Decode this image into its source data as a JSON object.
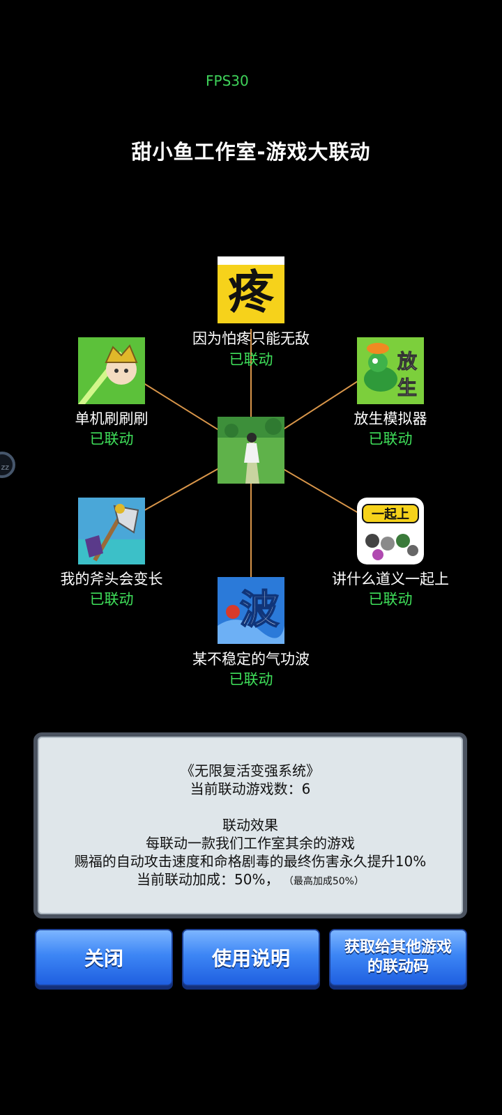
{
  "hud": {
    "fps": "FPS30",
    "side_handle": "zz"
  },
  "title": "甜小鱼工作室-游戏大联动",
  "center_game": {
    "icon": "girl-in-meadow-icon"
  },
  "games": [
    {
      "name": "因为怕疼只能无敌",
      "status": "已联动",
      "icon": "pain-character-icon",
      "icon_text": "疼"
    },
    {
      "name": "放生模拟器",
      "status": "已联动",
      "icon": "turtle-icon",
      "icon_text": "放生"
    },
    {
      "name": "讲什么道义一起上",
      "status": "已联动",
      "icon": "crowd-icon",
      "icon_text": "一起上"
    },
    {
      "name": "某不稳定的气功波",
      "status": "已联动",
      "icon": "wave-icon",
      "icon_text": "波"
    },
    {
      "name": "我的斧头会变长",
      "status": "已联动",
      "icon": "axe-icon"
    },
    {
      "name": "单机刷刷刷",
      "status": "已联动",
      "icon": "warrior-icon"
    }
  ],
  "panel": {
    "system_name": "《无限复活变强系统》",
    "count_line": "当前联动游戏数：6",
    "effect_title": "联动效果",
    "effect_line1": "每联动一款我们工作室其余的游戏",
    "effect_line2": "赐福的自动攻击速度和命格剧毒的最终伤害永久提升10%",
    "bonus_line": "当前联动加成：50%，",
    "bonus_note": "（最高加成50%）"
  },
  "buttons": {
    "close": "关闭",
    "help": "使用说明",
    "code_line1": "获取给其他游戏",
    "code_line2": "的联动码"
  },
  "colors": {
    "status_green": "#3fe05a",
    "link_line": "#d9964a",
    "button_blue": "#3d86f5"
  }
}
